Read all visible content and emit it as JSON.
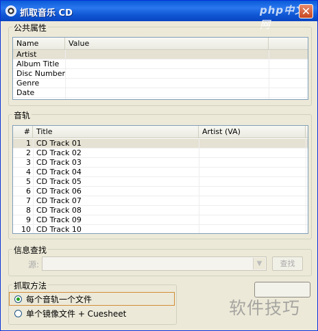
{
  "window": {
    "title": "抓取音乐 CD",
    "close_label": "✕",
    "watermark_logo": "php中文网"
  },
  "common": {
    "group_title": "公共属性",
    "headers": [
      "Name",
      "Value"
    ],
    "rows": [
      {
        "name": "Artist",
        "value": ""
      },
      {
        "name": "Album Title",
        "value": ""
      },
      {
        "name": "Disc Number",
        "value": ""
      },
      {
        "name": "Genre",
        "value": ""
      },
      {
        "name": "Date",
        "value": ""
      }
    ]
  },
  "tracks": {
    "group_title": "音轨",
    "headers": [
      "#",
      "Title",
      "Artist (VA)"
    ],
    "rows": [
      {
        "num": "1",
        "title": "CD Track 01",
        "artist": ""
      },
      {
        "num": "2",
        "title": "CD Track 02",
        "artist": ""
      },
      {
        "num": "3",
        "title": "CD Track 03",
        "artist": ""
      },
      {
        "num": "4",
        "title": "CD Track 04",
        "artist": ""
      },
      {
        "num": "5",
        "title": "CD Track 05",
        "artist": ""
      },
      {
        "num": "6",
        "title": "CD Track 06",
        "artist": ""
      },
      {
        "num": "7",
        "title": "CD Track 07",
        "artist": ""
      },
      {
        "num": "8",
        "title": "CD Track 08",
        "artist": ""
      },
      {
        "num": "9",
        "title": "CD Track 09",
        "artist": ""
      },
      {
        "num": "10",
        "title": "CD Track 10",
        "artist": ""
      }
    ]
  },
  "lookup": {
    "group_title": "信息查找",
    "source_label": "源:",
    "source_value": "",
    "search_label": "查找"
  },
  "rip_method": {
    "group_title": "抓取方法",
    "options": [
      {
        "label": "每个音轨一个文件",
        "selected": true
      },
      {
        "label": "单个镜像文件 + Cuesheet",
        "selected": false
      }
    ]
  },
  "watermark": {
    "text": "软件技巧"
  },
  "colors": {
    "titlebar": "#0a5bd8",
    "face": "#ece9d8",
    "selected_row": "#e5e1d3",
    "radio_focus": "#d08b35"
  }
}
